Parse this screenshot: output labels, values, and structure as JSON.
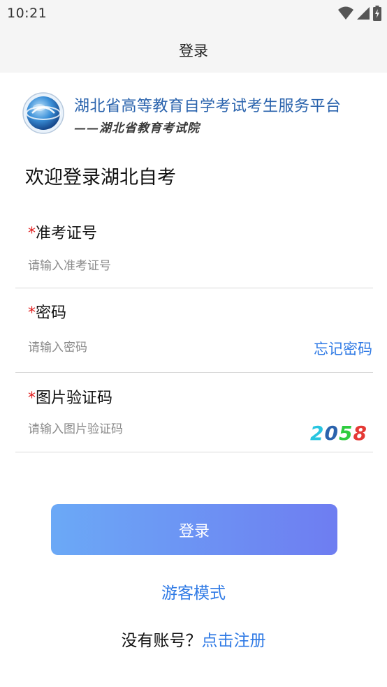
{
  "status_bar": {
    "time": "10:21"
  },
  "app_bar": {
    "title": "登录"
  },
  "logo": {
    "title": "湖北省高等教育自学考试考生服务平台",
    "subtitle": "——湖北省教育考试院"
  },
  "welcome": "欢迎登录湖北自考",
  "form": {
    "required_mark": "*",
    "exam_number": {
      "label": "准考证号",
      "placeholder": "请输入准考证号"
    },
    "password": {
      "label": "密码",
      "placeholder": "请输入密码",
      "forgot_label": "忘记密码"
    },
    "captcha": {
      "label": "图片验证码",
      "placeholder": "请输入图片验证码",
      "digits": [
        {
          "char": "2",
          "color": "#28c5e0"
        },
        {
          "char": "0",
          "color": "#2a63ad"
        },
        {
          "char": "5",
          "color": "#2ecc40"
        },
        {
          "char": "8",
          "color": "#e53935"
        }
      ]
    }
  },
  "login_button_label": "登录",
  "guest_mode_label": "游客模式",
  "register": {
    "question": "没有账号？",
    "link_label": "点击注册"
  },
  "colors": {
    "link": "#2f7ae5",
    "required": "#e02020",
    "button_gradient_start": "#6ba9f6",
    "button_gradient_end": "#6e7df1"
  }
}
